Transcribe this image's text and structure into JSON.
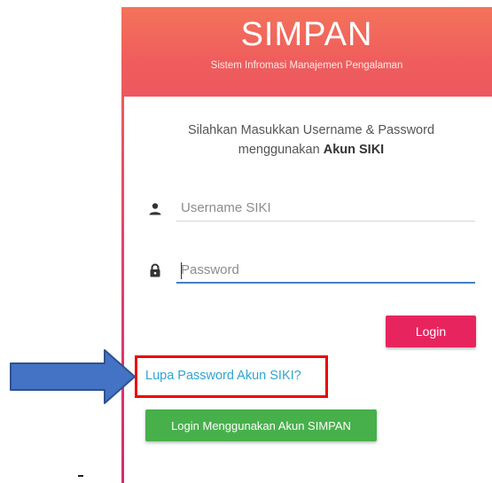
{
  "header": {
    "title": "SIMPAN",
    "subtitle": "Sistem Infromasi Manajemen Pengalaman"
  },
  "intro": {
    "line1": "Silahkan Masukkan Username & Password",
    "line2_prefix": "menggunakan ",
    "line2_bold": "Akun SIKI"
  },
  "form": {
    "username": {
      "placeholder": "Username SIKI",
      "value": "",
      "icon": "person-icon"
    },
    "password": {
      "placeholder": "Password",
      "value": "",
      "icon": "lock-icon"
    },
    "login_label": "Login",
    "forgot_label": "Lupa Password Akun SIKI?",
    "simpan_login_label": "Login Menggunakan Akun SIMPAN"
  },
  "annotation": {
    "arrow_icon": "arrow-right-icon",
    "highlight_color": "#ee0000",
    "arrow_color": "#4472c4"
  },
  "colors": {
    "header": "#ef5d5d",
    "login_button": "#e8245f",
    "simpan_button": "#47b04b",
    "link": "#2fa4d3",
    "input_focus": "#3f82c4"
  }
}
